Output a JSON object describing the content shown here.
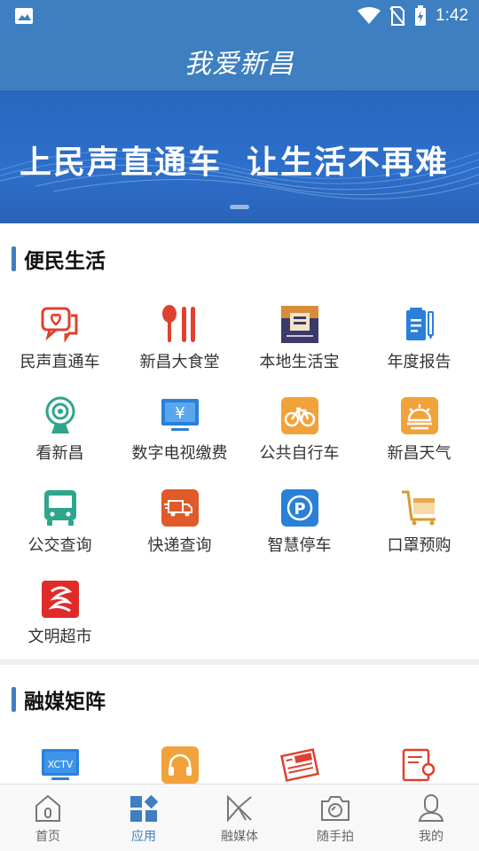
{
  "status_bar": {
    "time": "1:42"
  },
  "header": {
    "title": "我爱新昌"
  },
  "banner": {
    "text_part1": "上民声直通车",
    "text_part2": "让生活不再难"
  },
  "section_life": {
    "title": "便民生活",
    "items": [
      {
        "label": "民声直通车",
        "icon": "chat-heart-icon"
      },
      {
        "label": "新昌大食堂",
        "icon": "spoon-chopsticks-icon"
      },
      {
        "label": "本地生活宝",
        "icon": "local-life-logo-icon"
      },
      {
        "label": "年度报告",
        "icon": "report-clipboard-icon"
      },
      {
        "label": "看新昌",
        "icon": "camera-icon"
      },
      {
        "label": "数字电视缴费",
        "icon": "tv-yen-icon"
      },
      {
        "label": "公共自行车",
        "icon": "bicycle-icon"
      },
      {
        "label": "新昌天气",
        "icon": "weather-icon"
      },
      {
        "label": "公交查询",
        "icon": "bus-icon"
      },
      {
        "label": "快递查询",
        "icon": "delivery-truck-icon"
      },
      {
        "label": "智慧停车",
        "icon": "parking-icon"
      },
      {
        "label": "口罩预购",
        "icon": "shopping-cart-icon"
      },
      {
        "label": "文明超市",
        "icon": "civilization-market-icon"
      }
    ]
  },
  "section_media": {
    "title": "融媒矩阵",
    "items": [
      {
        "label": "XCTV",
        "icon": "tv-xctv-icon"
      },
      {
        "label": "",
        "icon": "headphones-icon"
      },
      {
        "label": "",
        "icon": "newspaper-icon"
      },
      {
        "label": "",
        "icon": "document-person-icon"
      }
    ]
  },
  "tab_bar": {
    "tabs": [
      {
        "label": "首页",
        "icon": "home-icon"
      },
      {
        "label": "应用",
        "icon": "apps-icon"
      },
      {
        "label": "融媒体",
        "icon": "media-icon"
      },
      {
        "label": "随手拍",
        "icon": "camera-shoot-icon"
      },
      {
        "label": "我的",
        "icon": "profile-icon"
      }
    ],
    "active_index": 1
  },
  "colors": {
    "brand_blue": "#3d7fc1",
    "red": "#e0402f",
    "orange": "#f2a23a",
    "teal": "#2fa58c"
  }
}
